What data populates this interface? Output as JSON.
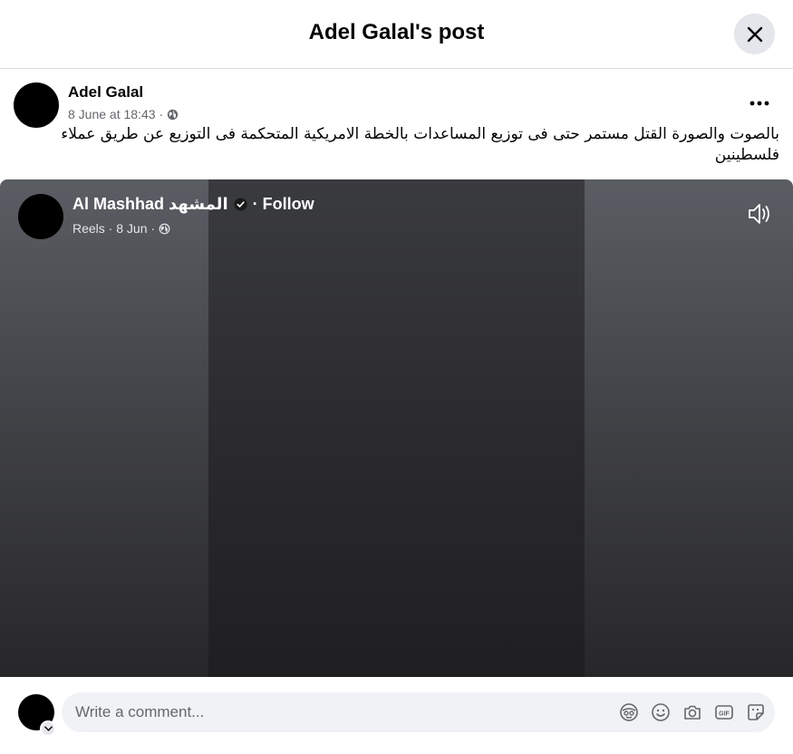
{
  "header": {
    "title": "Adel Galal's post"
  },
  "post": {
    "author": "Adel Galal",
    "timestamp": "8 June at 18:43",
    "separator": "·",
    "audience_icon": "globe-icon",
    "text": "بالصوت والصورة القتل مستمر حتى فى توزيع المساعدات بالخطة الامريكية المتحكمة فى التوزيع عن طريق عملاء فلسطينين"
  },
  "reel": {
    "source_name": "Al Mashhad المشهد",
    "verified_icon": "verified-badge-icon",
    "follow_label": "· Follow",
    "sub": "Reels · 8 Jun ·",
    "audience_icon": "globe-icon",
    "sound_icon": "speaker-icon"
  },
  "comment": {
    "placeholder": "Write a comment...",
    "icons": [
      "avatar-sticker-icon",
      "emoji-icon",
      "camera-icon",
      "gif-icon",
      "sticker-icon"
    ]
  },
  "colors": {
    "secondary_text": "#65676b",
    "input_bg": "#f0f2f5",
    "button_bg": "#e4e6eb"
  }
}
